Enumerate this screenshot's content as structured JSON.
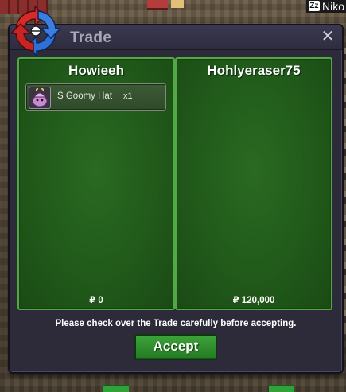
{
  "background": {
    "name_tag": "Niko",
    "zz_badge": "Zz"
  },
  "window": {
    "title": "Trade",
    "close_glyph": "✕",
    "logo_icon": "trade-arrows-icon"
  },
  "left_panel": {
    "player_name": "Howieeh",
    "items": [
      {
        "name": "S Goomy Hat",
        "qty": "x1",
        "icon": "goomy-hat-icon"
      }
    ],
    "money": "₽ 0"
  },
  "right_panel": {
    "player_name": "Hohlyeraser75",
    "items": [],
    "money": "₽ 120,000"
  },
  "footer": {
    "message": "Please check over the Trade carefully before accepting.",
    "accept_label": "Accept"
  },
  "colors": {
    "panel_border": "#52a845",
    "panel_fill": "#215a1a",
    "window_bg": "#2d2b3a",
    "accept_button": "#2f8f2d"
  }
}
